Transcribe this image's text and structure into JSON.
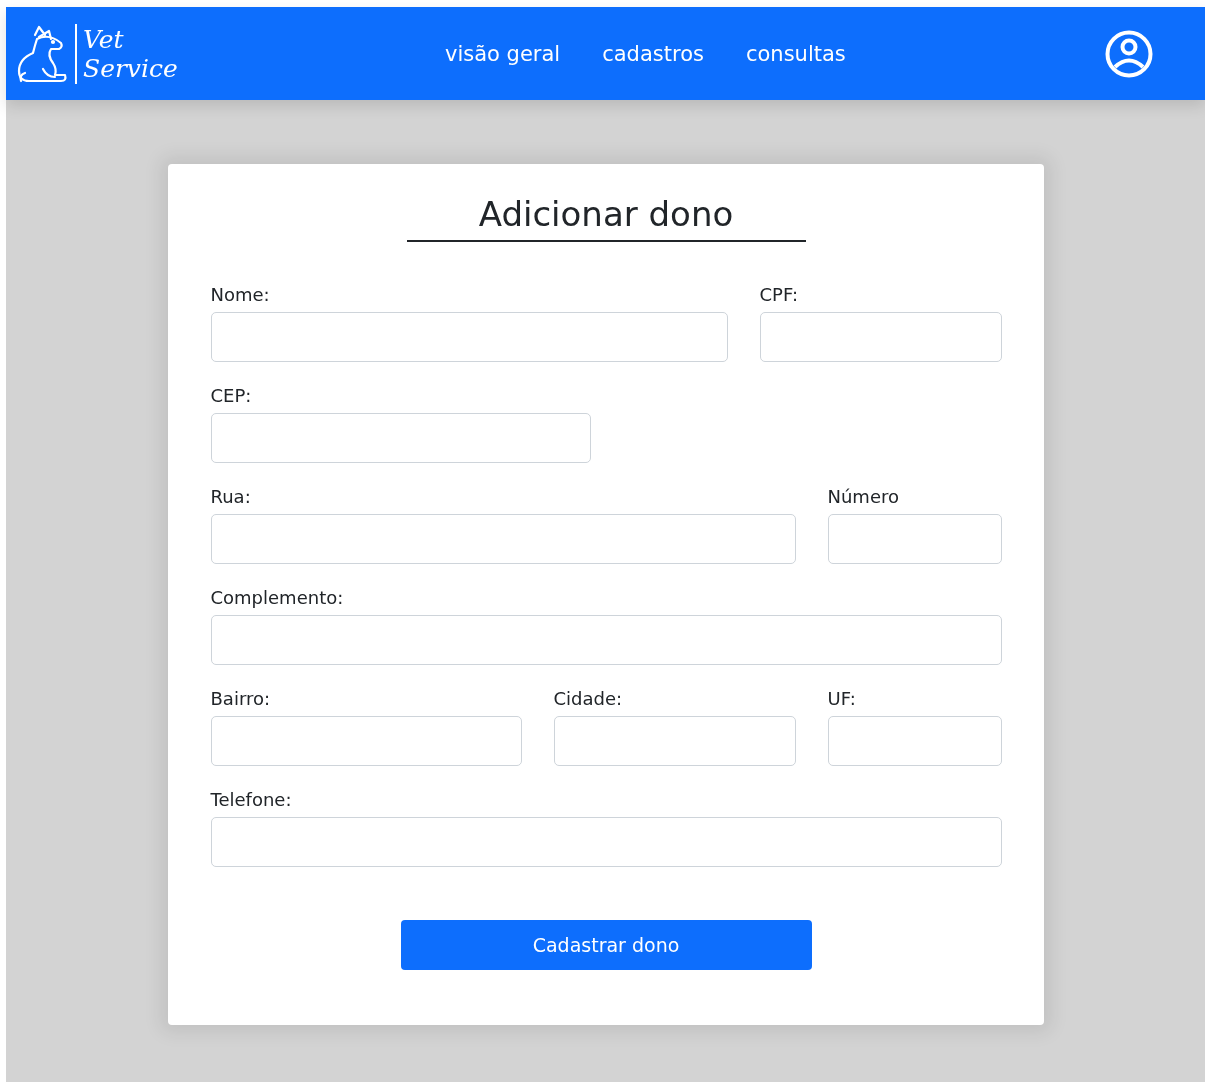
{
  "brand": {
    "line_1": "Vet",
    "line_2": "Service"
  },
  "nav": [
    {
      "label": "visão geral"
    },
    {
      "label": "cadastros"
    },
    {
      "label": "consultas"
    }
  ],
  "form": {
    "title": "Adicionar dono",
    "fields": [
      {
        "label": "Nome:"
      },
      {
        "label": "CPF:"
      },
      {
        "label": "CEP:"
      },
      {
        "label": "Rua:"
      },
      {
        "label": "Número"
      },
      {
        "label": "Complemento:"
      },
      {
        "label": "Bairro:"
      },
      {
        "label": "Cidade:"
      },
      {
        "label": "UF:"
      },
      {
        "label": "Telefone:"
      }
    ],
    "submit": "Cadastrar dono"
  }
}
